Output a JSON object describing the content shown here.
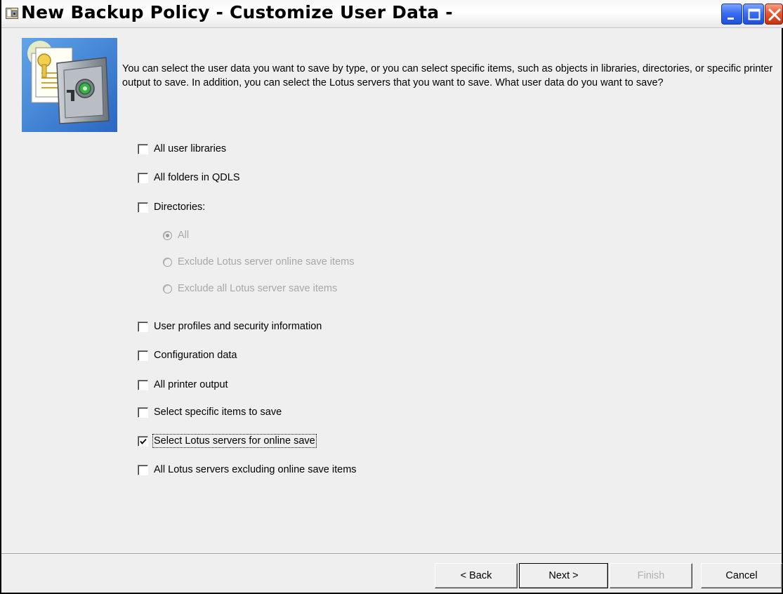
{
  "window": {
    "title": "New Backup Policy - Customize User Data -"
  },
  "intro_text": "You can select the user data you want to save by type, or you can select specific items, such as objects in libraries, directories, or specific printer output to save. In addition, you can select the Lotus servers that you want to save. What user data do you want to save?",
  "options": [
    {
      "label": "All user libraries",
      "checked": false
    },
    {
      "label": "All folders in QDLS",
      "checked": false
    },
    {
      "label": "Directories:",
      "checked": false
    },
    {
      "label": "User profiles and security information",
      "checked": false
    },
    {
      "label": "Configuration data",
      "checked": false
    },
    {
      "label": "All printer output",
      "checked": false
    },
    {
      "label": "Select specific items to save",
      "checked": false
    },
    {
      "label": "Select Lotus servers for online save",
      "checked": true
    },
    {
      "label": "All Lotus servers excluding online save items",
      "checked": false
    }
  ],
  "directory_options": [
    {
      "label": "All",
      "selected": true,
      "enabled": false
    },
    {
      "label": "Exclude Lotus server online save items",
      "selected": false,
      "enabled": false
    },
    {
      "label": "Exclude all Lotus server save items",
      "selected": false,
      "enabled": false
    }
  ],
  "buttons": {
    "back": "< Back",
    "next": "Next >",
    "finish": "Finish",
    "cancel": "Cancel"
  },
  "colors": {
    "window_bg": "#efefef",
    "disabled_text": "#a8a8a8",
    "close_button": "#c43312",
    "title_buttons": "#3b6ef3"
  }
}
